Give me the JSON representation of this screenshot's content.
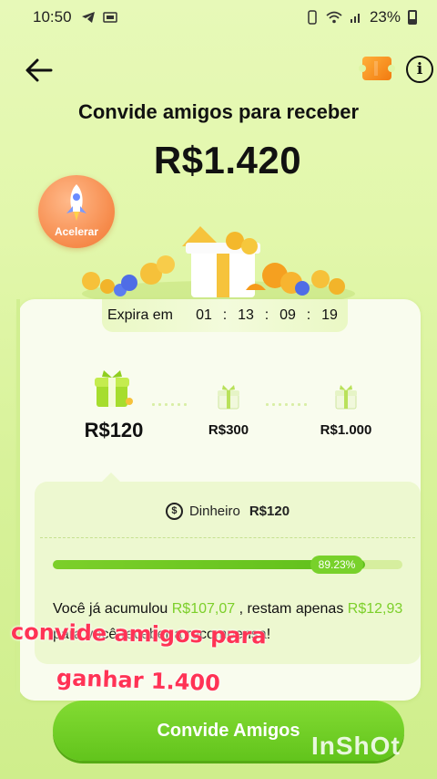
{
  "status_bar": {
    "time": "10:50",
    "battery": "23%"
  },
  "header": {
    "title": "Convide amigos para receber",
    "amount": "R$1.420"
  },
  "accelerate": {
    "label": "Acelerar"
  },
  "expiry": {
    "label": "Expira em",
    "days": "01",
    "hours": "13",
    "minutes": "09",
    "seconds": "19"
  },
  "tiers": [
    {
      "value": "R$120"
    },
    {
      "value": "R$300"
    },
    {
      "value": "R$1.000"
    }
  ],
  "reward": {
    "label": "Dinheiro",
    "value": "R$120"
  },
  "progress": {
    "percent_label": "89.23%",
    "fraction": 0.8923
  },
  "info": {
    "prefix": "Você já acumulou ",
    "accumulated": "R$107,07",
    "middle": " , restam apenas ",
    "remaining": "R$12,93",
    "suffix": " para você receber a recompensa!"
  },
  "overlay": {
    "line1": "convide amigos para",
    "line2": "ganhar 1.400"
  },
  "cta": {
    "label": "Convide Amigos"
  },
  "watermark": "InShOt",
  "colors": {
    "accent_green": "#7ccf2a",
    "caption_red": "#ff3355",
    "background": "#e2f7ab"
  },
  "icons": [
    "back-arrow-icon",
    "ticket-icon",
    "info-icon",
    "rocket-icon",
    "gift-box-icon",
    "dollar-coin-icon",
    "telegram-icon",
    "wifi-icon",
    "signal-icon",
    "battery-icon"
  ]
}
